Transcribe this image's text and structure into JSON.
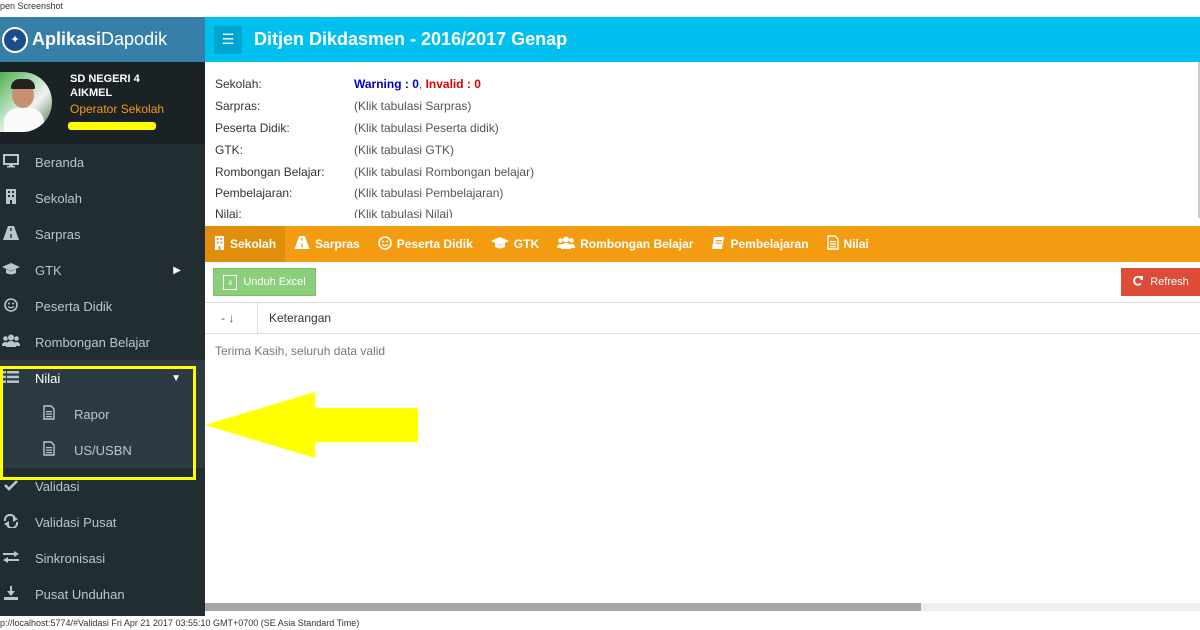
{
  "window": {
    "caption": "pen Screenshot",
    "status_url": "p://localhost:5774/#Validasi Fri Apr 21 2017 03:55:10 GMT+0700 (SE Asia Standard Time)"
  },
  "brand": {
    "bold": "Aplikasi",
    "normal": "Dapodik"
  },
  "user": {
    "school_line1": "SD NEGERI 4",
    "school_line2": "AIKMEL",
    "role": "Operator Sekolah"
  },
  "header": {
    "title": "Ditjen Dikdasmen - 2016/2017 Genap"
  },
  "sidebar": {
    "items": [
      {
        "label": "Beranda",
        "icon": "monitor-icon"
      },
      {
        "label": "Sekolah",
        "icon": "building-icon"
      },
      {
        "label": "Sarpras",
        "icon": "road-icon"
      },
      {
        "label": "GTK",
        "icon": "graduation-cap-icon"
      },
      {
        "label": "Peserta Didik",
        "icon": "smile-icon"
      },
      {
        "label": "Rombongan Belajar",
        "icon": "users-icon"
      },
      {
        "label": "Nilai",
        "icon": "list-icon"
      },
      {
        "label": "Validasi",
        "icon": "check-icon"
      },
      {
        "label": "Validasi Pusat",
        "icon": "exchange-icon"
      },
      {
        "label": "Sinkronisasi",
        "icon": "sync-icon"
      },
      {
        "label": "Pusat Unduhan",
        "icon": "download-icon"
      }
    ],
    "nilai_sub": [
      {
        "label": "Rapor",
        "icon": "file-icon"
      },
      {
        "label": "US/USBN",
        "icon": "file-icon"
      }
    ]
  },
  "info": {
    "rows": [
      {
        "label": "Sekolah:",
        "warning": "Warning : 0",
        "sep": ", ",
        "invalid": "Invalid : 0"
      },
      {
        "label": "Sarpras:",
        "value": "(Klik tabulasi Sarpras)"
      },
      {
        "label": "Peserta Didik:",
        "value": "(Klik tabulasi Peserta didik)"
      },
      {
        "label": "GTK:",
        "value": "(Klik tabulasi GTK)"
      },
      {
        "label": "Rombongan Belajar:",
        "value": "(Klik tabulasi Rombongan belajar)"
      },
      {
        "label": "Pembelajaran:",
        "value": "(Klik tabulasi Pembelajaran)"
      },
      {
        "label": "Nilai:",
        "value": "(Klik tabulasi Nilai)"
      }
    ]
  },
  "tabs": [
    {
      "label": "Sekolah",
      "icon": "building-icon"
    },
    {
      "label": "Sarpras",
      "icon": "road-icon"
    },
    {
      "label": "Peserta Didik",
      "icon": "smile-icon"
    },
    {
      "label": "GTK",
      "icon": "graduation-cap-icon"
    },
    {
      "label": "Rombongan Belajar",
      "icon": "users-icon"
    },
    {
      "label": "Pembelajaran",
      "icon": "book-icon"
    },
    {
      "label": "Nilai",
      "icon": "file-icon"
    }
  ],
  "toolbar": {
    "excel_label": "Unduh Excel",
    "refresh_label": "Refresh"
  },
  "grid": {
    "sort_label": "- ↓",
    "column_keterangan": "Keterangan",
    "empty_message": "Terima Kasih, seluruh data valid"
  },
  "colors": {
    "header": "#00c0ef",
    "brand": "#367fa9",
    "sidebar": "#222d32",
    "tabs": "#f39c12",
    "refresh": "#dd4b39",
    "excel": "#8ccf7a",
    "highlight": "#ffff00"
  }
}
